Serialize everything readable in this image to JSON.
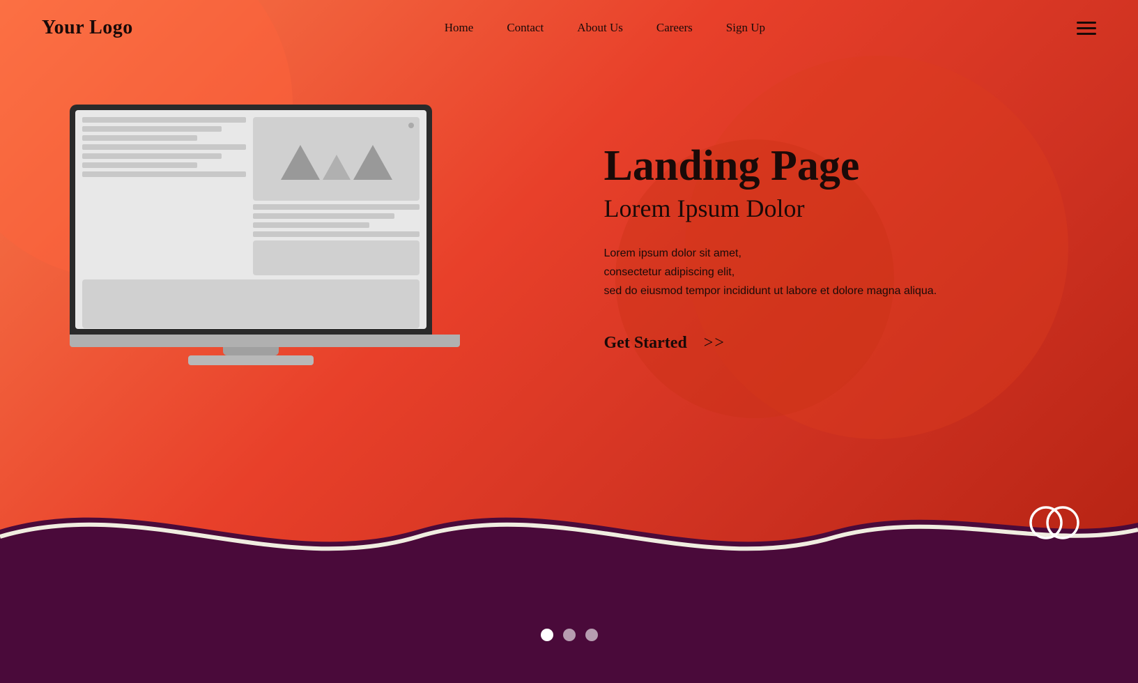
{
  "brand": {
    "logo": "Your Logo"
  },
  "nav": {
    "items": [
      {
        "label": "Home",
        "id": "home"
      },
      {
        "label": "Contact",
        "id": "contact"
      },
      {
        "label": "About Us",
        "id": "about"
      },
      {
        "label": "Careers",
        "id": "careers"
      },
      {
        "label": "Sign Up",
        "id": "signup"
      }
    ]
  },
  "hero": {
    "title": "Landing Page",
    "subtitle": "Lorem Ipsum Dolor",
    "body_line1": "Lorem ipsum dolor sit amet,",
    "body_line2": "consectetur adipiscing elit,",
    "body_line3": "sed do eiusmod tempor incididunt ut labore et dolore magna aliqua.",
    "cta_label": "Get Started",
    "cta_arrow": ">>"
  },
  "dots": [
    {
      "active": true
    },
    {
      "active": false
    },
    {
      "active": false
    }
  ],
  "colors": {
    "bg_gradient_start": "#f87a4a",
    "bg_gradient_end": "#b02010",
    "wave_fill": "#4a0a3a",
    "wave_stroke": "#f0ede0",
    "text_dark": "#1a0a08"
  }
}
